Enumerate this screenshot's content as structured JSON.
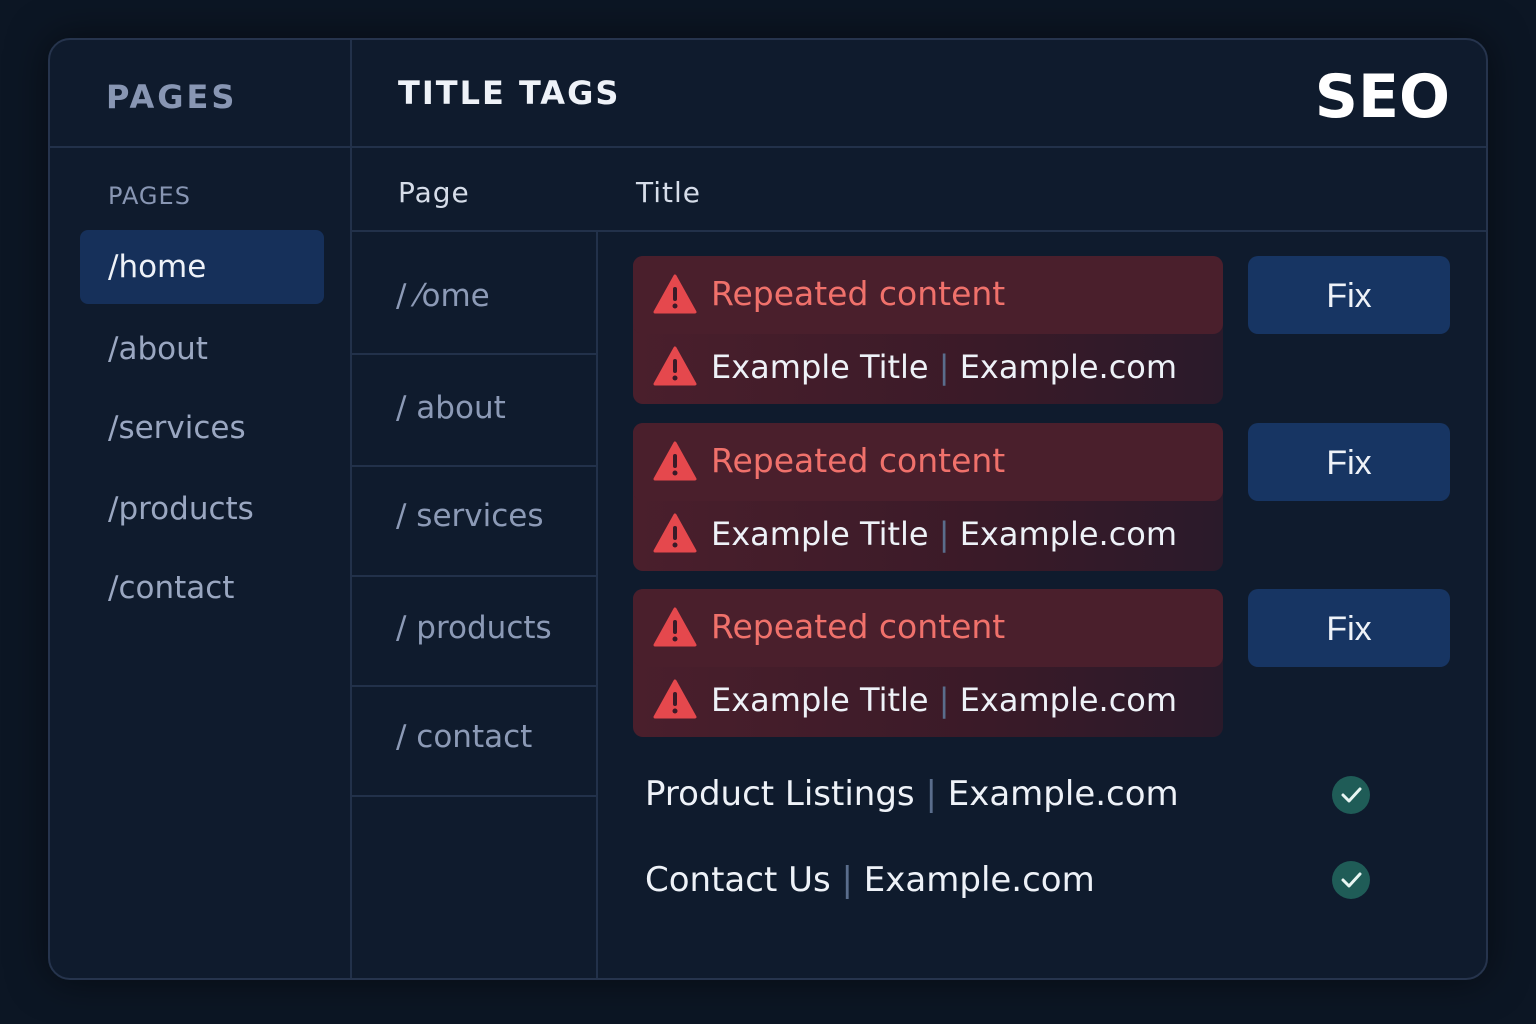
{
  "sidebar": {
    "title": "PAGES",
    "subtitle": "PAGES",
    "items": [
      {
        "label": "/home",
        "active": true
      },
      {
        "label": "/about",
        "active": false
      },
      {
        "label": "/services",
        "active": false
      },
      {
        "label": "/products",
        "active": false
      },
      {
        "label": "/contact",
        "active": false
      }
    ]
  },
  "header": {
    "title": "TITLE TAGS",
    "logo": "SEO"
  },
  "table": {
    "columns": {
      "page": "Page",
      "title": "Title"
    },
    "pages": [
      "/  ⁄ome",
      "/  about",
      "/ services",
      "/ products",
      "/ contact"
    ],
    "issues": [
      {
        "label": "Repeated content",
        "title": "Example Title",
        "site": "Example.com",
        "action": "Fix"
      },
      {
        "label": "Repeated content",
        "title": "Example Title",
        "site": "Example.com",
        "action": "Fix"
      },
      {
        "label": "Repeated content",
        "title": "Example Title",
        "site": "Example.com",
        "action": "Fix"
      }
    ],
    "ok_rows": [
      {
        "title": "Product Listings",
        "site": "Example.com"
      },
      {
        "title": "Contact Us",
        "site": "Example.com"
      }
    ],
    "separator": "|"
  },
  "colors": {
    "background": "#0c1624",
    "panel": "#0f1b2d",
    "accent": "#173563",
    "warning": "#e5484d",
    "warning_text": "#f0716b",
    "success": "#1f5c57"
  },
  "icons": {
    "warning": "warning-triangle-icon",
    "ok": "check-circle-icon"
  }
}
